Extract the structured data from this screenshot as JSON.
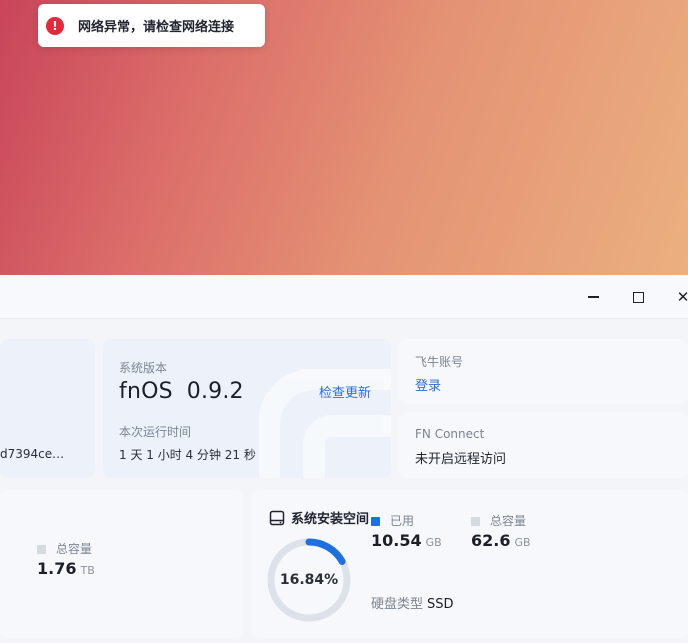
{
  "toast": {
    "message": "网络异常，请检查网络连接",
    "icon": "error-icon",
    "icon_color": "#e5293b"
  },
  "window": {
    "controls": [
      "minimize-icon",
      "maximize-icon",
      "close-icon"
    ]
  },
  "device": {
    "id_fragment": "d7394ce…"
  },
  "version_card": {
    "label": "系统版本",
    "os_name": "fnOS",
    "version": "0.9.2",
    "check_update": "检查更新",
    "uptime_label": "本次运行时间",
    "uptime_value": "1 天 1 小时 4 分钟 21 秒"
  },
  "account_card": {
    "label": "飞牛账号",
    "action": "登录"
  },
  "connect_card": {
    "label": "FN Connect",
    "status": "未开启远程访问"
  },
  "storage_left": {
    "total_label": "总容量",
    "total_value": "1.76",
    "total_unit": "TB"
  },
  "system_space": {
    "title": "系统安装空间",
    "percent_text": "16.84%",
    "percent_used": 16.84,
    "used_label": "已用",
    "used_value": "10.54",
    "used_unit": "GB",
    "total_label": "总容量",
    "total_value": "62.6",
    "total_unit": "GB",
    "disk_type_label": "硬盘类型",
    "disk_type_value": "SSD",
    "used_color": "#1f6fe0",
    "free_color": "#dde2ea"
  }
}
